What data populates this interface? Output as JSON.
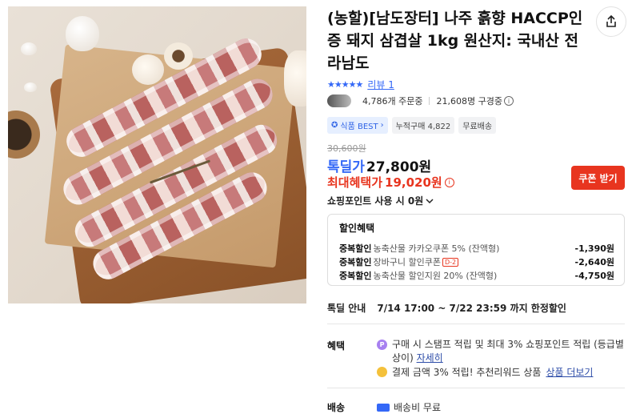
{
  "product": {
    "title": "(농할)[남도장터] 나주 흙향 HACCP인증 돼지 삼겹살 1kg 원산지: 국내산 전라남도",
    "share_icon": "share-icon"
  },
  "rating": {
    "stars": "★★★★★",
    "review_label": "리뷰 1"
  },
  "stats": {
    "orders": "4,786개 주문중",
    "subscribers": "21,608명 구경중"
  },
  "tags": {
    "best": "식품 BEST",
    "cumulative": "누적구매 4,822",
    "free_shipping": "무료배송"
  },
  "price": {
    "original": "30,600원",
    "deal_label": "톡딜가",
    "deal_price": "27,800원",
    "max_benefit_label": "최대혜택가",
    "max_benefit_price": "19,020원",
    "coupon_button": "쿠폰 받기",
    "points_text": "쇼핑포인트 사용 시 0원"
  },
  "discount": {
    "heading": "할인혜택",
    "rows": [
      {
        "key": "중복할인",
        "desc": "농축산물 카카오쿠폰 5% (잔액형)",
        "badge": "",
        "amount": "-1,390원"
      },
      {
        "key": "중복할인",
        "desc": "장바구니 할인쿠폰",
        "badge": "D-2",
        "amount": "-2,640원"
      },
      {
        "key": "중복할인",
        "desc": "농축산물 할인지원 20% (잔액형)",
        "badge": "",
        "amount": "-4,750원"
      }
    ]
  },
  "deal_period": {
    "label": "톡딜 안내",
    "text": "7/14 17:00 ~ 7/22 23:59 까지 한정할인"
  },
  "benefits": {
    "label": "혜택",
    "line1": "구매 시 스탬프 적립 및 최대 3% 쇼핑포인트 적립 (등급별 상이)",
    "line1_link": "자세히",
    "line2": "결제 금액 3% 적립! 추천리워드 상품",
    "line2_link": "상품 더보기"
  },
  "shipping": {
    "label": "배송",
    "text": "배송비 무료"
  },
  "colors": {
    "accent_blue": "#3468f7",
    "accent_red": "#e8351f"
  }
}
